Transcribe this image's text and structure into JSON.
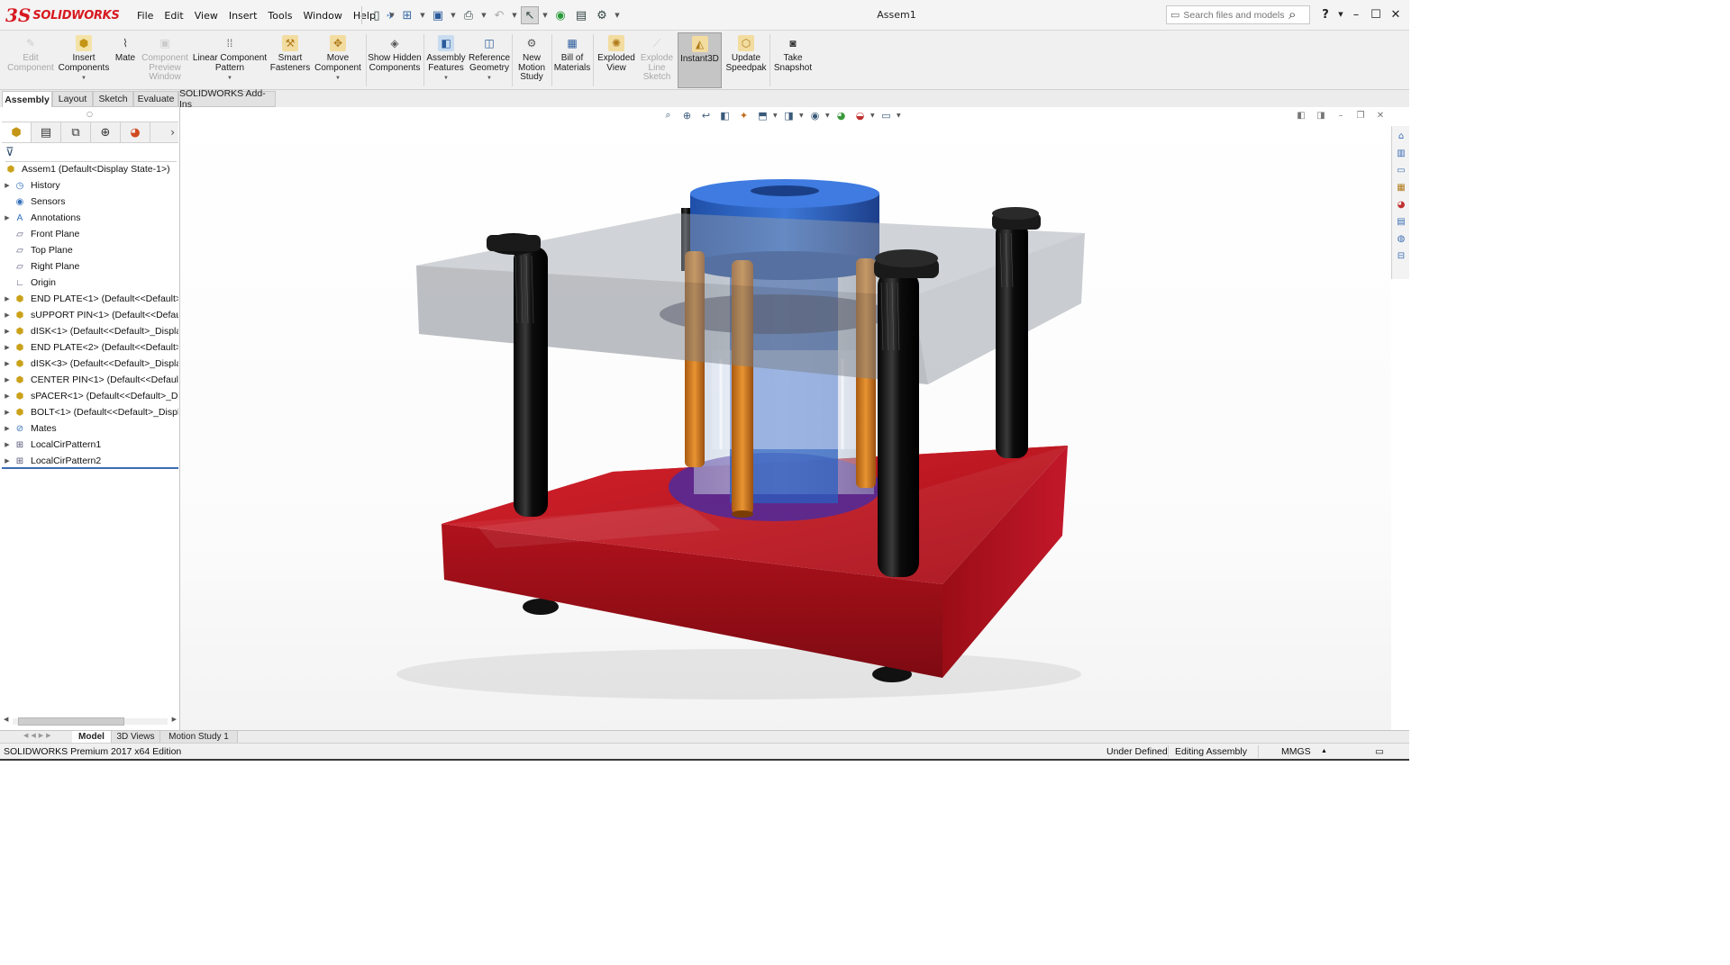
{
  "app": {
    "brand_mark": "3S",
    "brand_name": "SOLIDWORKS"
  },
  "menu": [
    "File",
    "Edit",
    "View",
    "Insert",
    "Tools",
    "Window",
    "Help"
  ],
  "window": {
    "title": "Assem1"
  },
  "search": {
    "placeholder": "Search files and models"
  },
  "ribbon": {
    "buttons": [
      {
        "label": "Edit Component",
        "disabled": true
      },
      {
        "label": "Insert Components",
        "disabled": false
      },
      {
        "label": "Mate",
        "disabled": false
      },
      {
        "label": "Component Preview Window",
        "disabled": true
      },
      {
        "label": "Linear Component Pattern",
        "disabled": false
      },
      {
        "label": "Smart Fasteners",
        "disabled": false
      },
      {
        "label": "Move Component",
        "disabled": false
      },
      {
        "label": "Show Hidden Components",
        "disabled": false
      },
      {
        "label": "Assembly Features",
        "disabled": false
      },
      {
        "label": "Reference Geometry",
        "disabled": false
      },
      {
        "label": "New Motion Study",
        "disabled": false
      },
      {
        "label": "Bill of Materials",
        "disabled": false
      },
      {
        "label": "Exploded View",
        "disabled": false
      },
      {
        "label": "Explode Line Sketch",
        "disabled": true
      },
      {
        "label": "Instant3D",
        "disabled": false,
        "active": true
      },
      {
        "label": "Update Speedpak",
        "disabled": false
      },
      {
        "label": "Take Snapshot",
        "disabled": false
      }
    ]
  },
  "command_tabs": [
    {
      "label": "Assembly",
      "active": true
    },
    {
      "label": "Layout"
    },
    {
      "label": "Sketch"
    },
    {
      "label": "Evaluate"
    },
    {
      "label": "SOLIDWORKS Add-Ins"
    }
  ],
  "tree": {
    "root": "Assem1  (Default<Display State-1>)",
    "items": [
      {
        "label": "History",
        "icon": "history-icon",
        "expandable": true
      },
      {
        "label": "Sensors",
        "icon": "sensor-icon",
        "expandable": false
      },
      {
        "label": "Annotations",
        "icon": "annotation-icon",
        "expandable": true
      },
      {
        "label": "Front Plane",
        "icon": "plane-icon",
        "expandable": false
      },
      {
        "label": "Top Plane",
        "icon": "plane-icon",
        "expandable": false
      },
      {
        "label": "Right Plane",
        "icon": "plane-icon",
        "expandable": false
      },
      {
        "label": "Origin",
        "icon": "origin-icon",
        "expandable": false
      },
      {
        "label": "END PLATE<1> (Default<<Default>_",
        "icon": "part-icon",
        "expandable": true
      },
      {
        "label": "sUPPORT PIN<1> (Default<<Default",
        "icon": "part-icon",
        "expandable": true
      },
      {
        "label": "dISK<1> (Default<<Default>_Displa",
        "icon": "part-icon",
        "expandable": true
      },
      {
        "label": "END PLATE<2> (Default<<Default>_",
        "icon": "part-icon",
        "expandable": true
      },
      {
        "label": "dISK<3> (Default<<Default>_Displa",
        "icon": "part-icon",
        "expandable": true
      },
      {
        "label": "CENTER PIN<1> (Default<<Default>",
        "icon": "part-icon",
        "expandable": true
      },
      {
        "label": "sPACER<1> (Default<<Default>_Dis",
        "icon": "part-icon",
        "expandable": true
      },
      {
        "label": "BOLT<1> (Default<<Default>_Displ:",
        "icon": "part-icon",
        "expandable": true
      },
      {
        "label": "Mates",
        "icon": "mates-icon",
        "expandable": true
      },
      {
        "label": "LocalCirPattern1",
        "icon": "pattern-icon",
        "expandable": true
      },
      {
        "label": "LocalCirPattern2",
        "icon": "pattern-icon",
        "expandable": true
      }
    ]
  },
  "bottom_tabs": [
    {
      "label": "Model",
      "active": true
    },
    {
      "label": "3D Views"
    },
    {
      "label": "Motion Study 1"
    }
  ],
  "status": {
    "edition": "SOLIDWORKS Premium 2017 x64 Edition",
    "state": "Under Defined",
    "mode": "Editing Assembly",
    "units": "MMGS"
  },
  "colors": {
    "brand": "#d71920",
    "base_plate": "#b5121b",
    "top_plate": "#9a9a9a",
    "center_column": "#2a5fbf",
    "support_pins": "#d4801f",
    "bolts": "#111111",
    "disk": "#5a2fa8"
  }
}
